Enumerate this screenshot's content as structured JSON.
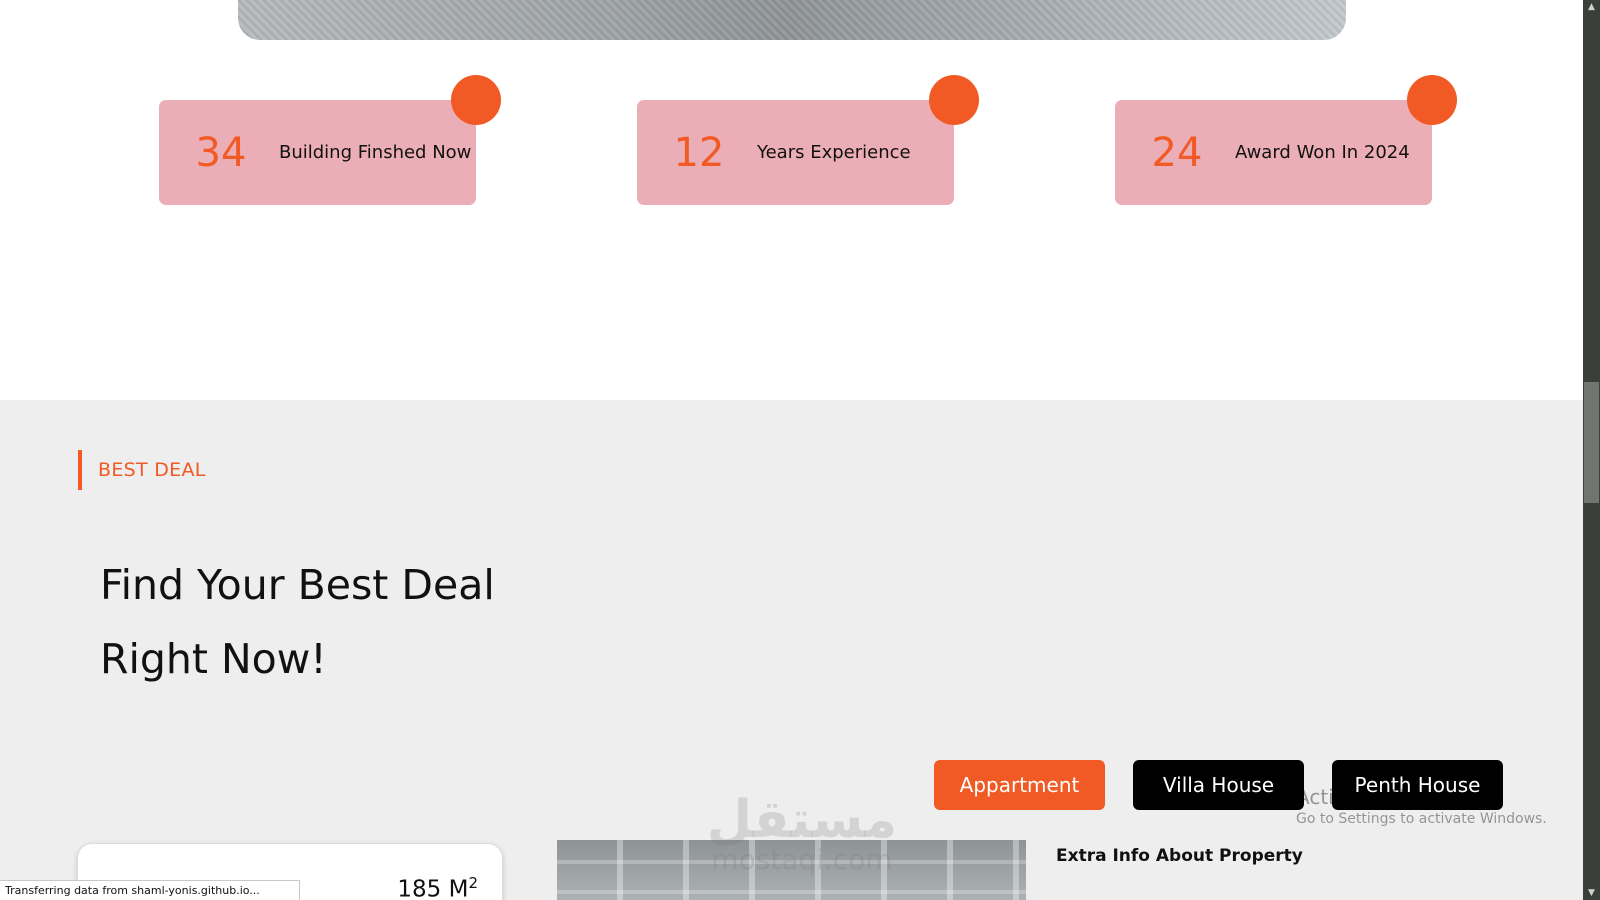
{
  "stats": [
    {
      "number": "34",
      "label": "Building Finshed Now"
    },
    {
      "number": "12",
      "label": "Years Experience"
    },
    {
      "number": "24",
      "label": "Award Won In 2024"
    }
  ],
  "deal": {
    "eyebrow": "BEST DEAL",
    "title_line1": "Find Your Best Deal",
    "title_line2": "Right Now!",
    "tabs": [
      {
        "label": "Appartment",
        "active": true
      },
      {
        "label": "Villa House",
        "active": false
      },
      {
        "label": "Penth House",
        "active": false
      }
    ],
    "card_area": "185 M",
    "card_area_unit_sup": "2",
    "extra_info": "Extra Info About Property"
  },
  "watermark": {
    "arabic": "مستقل",
    "latin": "mostaqi.com"
  },
  "os_overlay": {
    "title": "Activate Windows",
    "subtitle": "Go to Settings to activate Windows."
  },
  "status_bar": {
    "text": "Transferring data from shaml-yonis.github.io..."
  },
  "colors": {
    "accent": "#f15a24",
    "card_bg": "#ebaeb6",
    "section_bg": "#eeeeee",
    "tab_dark": "#000000"
  },
  "icons": {
    "scroll_up": "scroll-up-arrow-icon",
    "scroll_down": "scroll-down-arrow-icon"
  }
}
